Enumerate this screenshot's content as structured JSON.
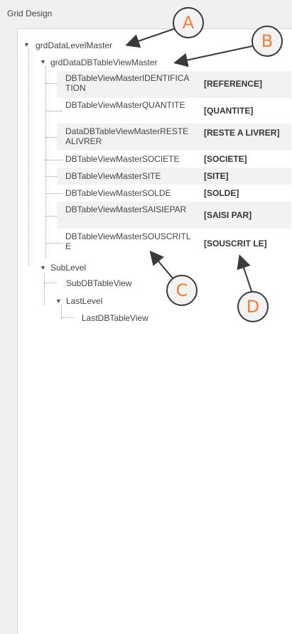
{
  "panel": {
    "title": "Grid Design"
  },
  "tree": {
    "root": {
      "label": "grdDataLevelMaster"
    },
    "view": {
      "label": "grdDataDBTableViewMaster"
    },
    "columns": [
      {
        "name": "DBTableViewMasterIDENTIFICATION",
        "caption": "[REFERENCE]"
      },
      {
        "name": "DBTableViewMasterQUANTITE",
        "caption": "[QUANTITE]"
      },
      {
        "name": "DataDBTableViewMasterRESTEALIVRER",
        "caption": "[RESTE A LIVRER]"
      },
      {
        "name": "DBTableViewMasterSOCIETE",
        "caption": "[SOCIETE]"
      },
      {
        "name": "DBTableViewMasterSITE",
        "caption": "[SITE]"
      },
      {
        "name": "DBTableViewMasterSOLDE",
        "caption": "[SOLDE]"
      },
      {
        "name": "DBTableViewMasterSAISIEPAR",
        "caption": "[SAISI PAR]"
      },
      {
        "name": "DBTableViewMasterSOUSCRITLE",
        "caption": "[SOUSCRIT LE]"
      }
    ],
    "sublevel": {
      "label": "SubLevel"
    },
    "subview": {
      "label": "SubDBTableView"
    },
    "lastlevel": {
      "label": "LastLevel"
    },
    "lastview": {
      "label": "LastDBTableView"
    }
  },
  "callouts": {
    "a": "A",
    "b": "B",
    "c": "C",
    "d": "D"
  },
  "colors": {
    "callout_text": "#f07b36",
    "callout_border": "#3a3a3a",
    "row_shade": "#f2f2f2"
  }
}
